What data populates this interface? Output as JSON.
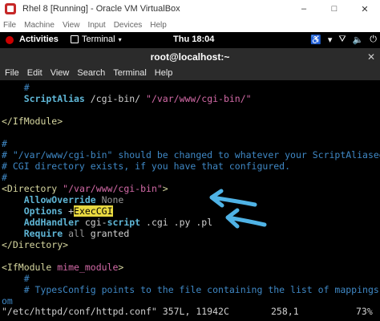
{
  "virtualbox": {
    "title": "Rhel 8 [Running] - Oracle VM VirtualBox",
    "minimize": "–",
    "maximize": "□",
    "close": "✕",
    "menu": [
      "File",
      "Machine",
      "View",
      "Input",
      "Devices",
      "Help"
    ]
  },
  "gnome": {
    "activities": "Activities",
    "app_name": "Terminal",
    "app_caret": "▾",
    "clock": "Thu 18:04",
    "status": {
      "accessibility": "♿",
      "caret": "▾",
      "network": "⛛",
      "volume": "🔈",
      "power": "⏻"
    }
  },
  "terminal": {
    "title": "root@localhost:~",
    "close": "✕",
    "menu": [
      "File",
      "Edit",
      "View",
      "Search",
      "Terminal",
      "Help"
    ]
  },
  "editor": {
    "lines": [
      [
        {
          "t": "    #",
          "c": "c-comment"
        }
      ],
      [
        {
          "t": "    ScriptAlias",
          "c": "c-dir"
        },
        {
          "t": " /cgi-bin/ ",
          "c": "c-txt"
        },
        {
          "t": "\"/var/www/cgi-bin/\"",
          "c": "c-str"
        }
      ],
      [],
      [
        {
          "t": "</IfModule>",
          "c": "c-tag"
        }
      ],
      [],
      [
        {
          "t": "#",
          "c": "c-comment"
        }
      ],
      [
        {
          "t": "# \"/var/www/cgi-bin\" should be changed to whatever your ScriptAliased",
          "c": "c-comment"
        }
      ],
      [
        {
          "t": "# CGI directory exists, if you have that configured.",
          "c": "c-comment"
        }
      ],
      [
        {
          "t": "#",
          "c": "c-comment"
        }
      ],
      [
        {
          "t": "<Directory ",
          "c": "c-tag"
        },
        {
          "t": "\"/var/www/cgi-bin\"",
          "c": "c-str"
        },
        {
          "t": ">",
          "c": "c-tag"
        }
      ],
      [
        {
          "t": "    AllowOverride",
          "c": "c-dir"
        },
        {
          "t": " None",
          "c": "c-dim"
        }
      ],
      [
        {
          "t": "    Options",
          "c": "c-dir"
        },
        {
          "t": " +",
          "c": "c-txt"
        },
        {
          "t": "ExecCGI",
          "c": "c-hl"
        }
      ],
      [
        {
          "t": "    AddHandler",
          "c": "c-dir"
        },
        {
          "t": " cgi-",
          "c": "c-txt"
        },
        {
          "t": "script",
          "c": "c-dir"
        },
        {
          "t": " .cgi .py .pl",
          "c": "c-txt"
        }
      ],
      [
        {
          "t": "    Require",
          "c": "c-dir"
        },
        {
          "t": " all",
          "c": "c-dim"
        },
        {
          "t": " granted",
          "c": "c-txt"
        }
      ],
      [
        {
          "t": "</Directory>",
          "c": "c-tag"
        }
      ],
      [],
      [
        {
          "t": "<IfModule ",
          "c": "c-tag"
        },
        {
          "t": "mime_module",
          "c": "c-str"
        },
        {
          "t": ">",
          "c": "c-tag"
        }
      ],
      [
        {
          "t": "    #",
          "c": "c-comment"
        }
      ],
      [
        {
          "t": "    # TypesConfig points to the file containing the list of mappings fr",
          "c": "c-comment"
        }
      ],
      [
        {
          "t": "om",
          "c": "c-comment"
        }
      ]
    ],
    "status": {
      "file": "\"/etc/httpd/conf/httpd.conf\" 357L, 11942C",
      "position": "258,1",
      "percent": "73%"
    }
  },
  "colors": {
    "annotation_arrow": "#4fb3e6"
  }
}
